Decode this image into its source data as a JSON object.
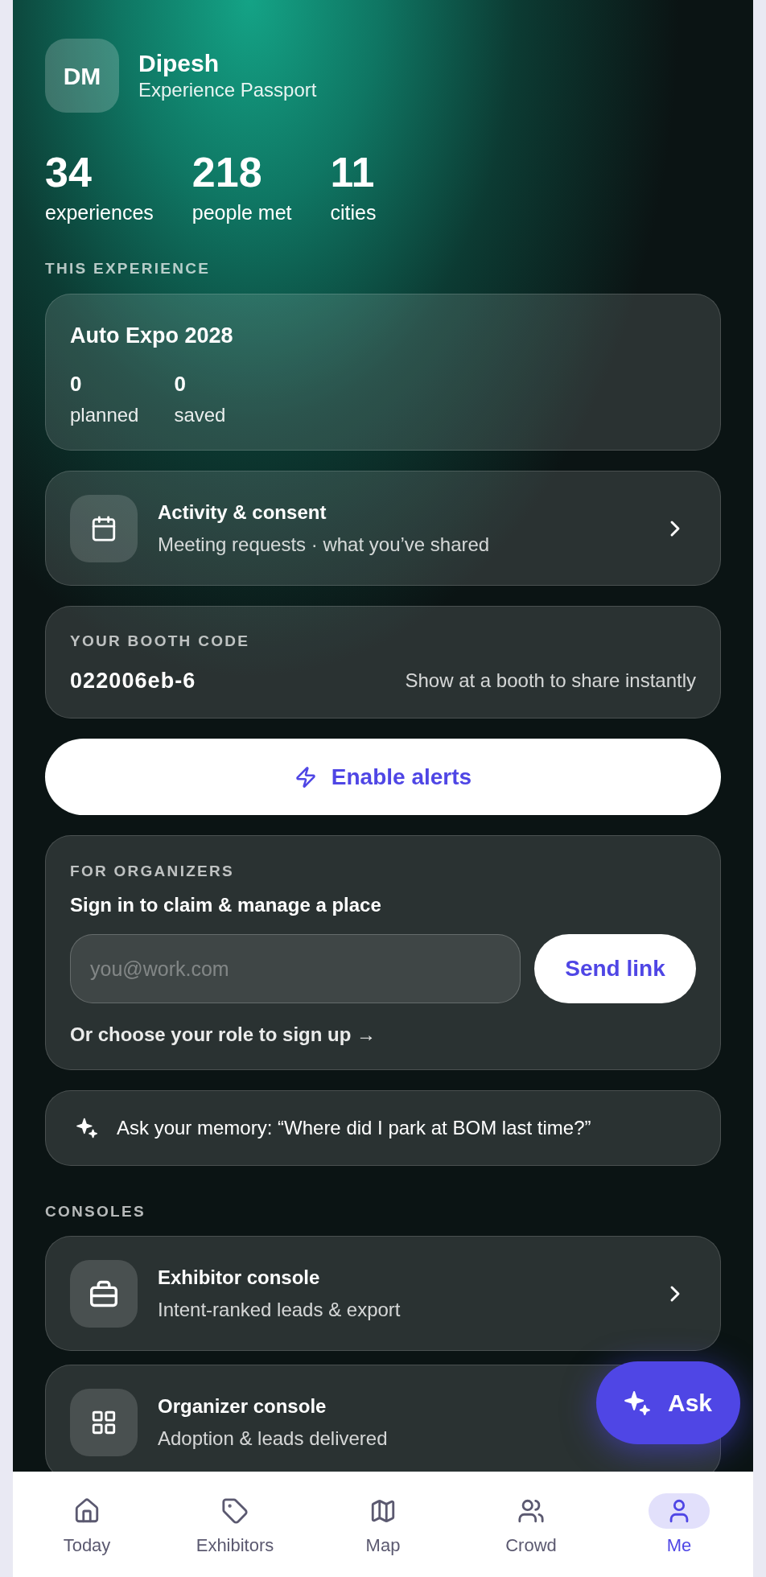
{
  "profile": {
    "initials": "DM",
    "name": "Dipesh",
    "subtitle": "Experience Passport"
  },
  "stats": [
    {
      "value": "34",
      "label": "experiences"
    },
    {
      "value": "218",
      "label": "people met"
    },
    {
      "value": "11",
      "label": "cities"
    }
  ],
  "this_experience": {
    "heading": "THIS EXPERIENCE",
    "title": "Auto Expo 2028",
    "stats": [
      {
        "value": "0",
        "label": "planned"
      },
      {
        "value": "0",
        "label": "saved"
      }
    ]
  },
  "activity": {
    "title": "Activity & consent",
    "subtitle": "Meeting requests · what you’ve shared"
  },
  "booth": {
    "heading": "YOUR BOOTH CODE",
    "code": "022006eb-6",
    "hint": "Show at a booth to share instantly"
  },
  "alerts_button": {
    "label": "Enable alerts"
  },
  "organizers": {
    "heading": "FOR ORGANIZERS",
    "title": "Sign in to claim & manage a place",
    "email_field": {
      "placeholder": "you@work.com"
    },
    "send_button": "Send link",
    "signup_link": "Or choose your role to sign up →"
  },
  "memory_prompt": {
    "text": "Ask your memory: “Where did I park at BOM last time?”"
  },
  "consoles": {
    "heading": "CONSOLES",
    "items": [
      {
        "title": "Exhibitor console",
        "subtitle": "Intent-ranked leads & export"
      },
      {
        "title": "Organizer console",
        "subtitle": "Adoption & leads delivered"
      }
    ]
  },
  "ask_button": {
    "label": "Ask"
  },
  "bottom_nav": [
    {
      "label": "Today",
      "selected": false
    },
    {
      "label": "Exhibitors",
      "selected": false
    },
    {
      "label": "Map",
      "selected": false
    },
    {
      "label": "Crowd",
      "selected": false
    },
    {
      "label": "Me",
      "selected": true
    }
  ]
}
